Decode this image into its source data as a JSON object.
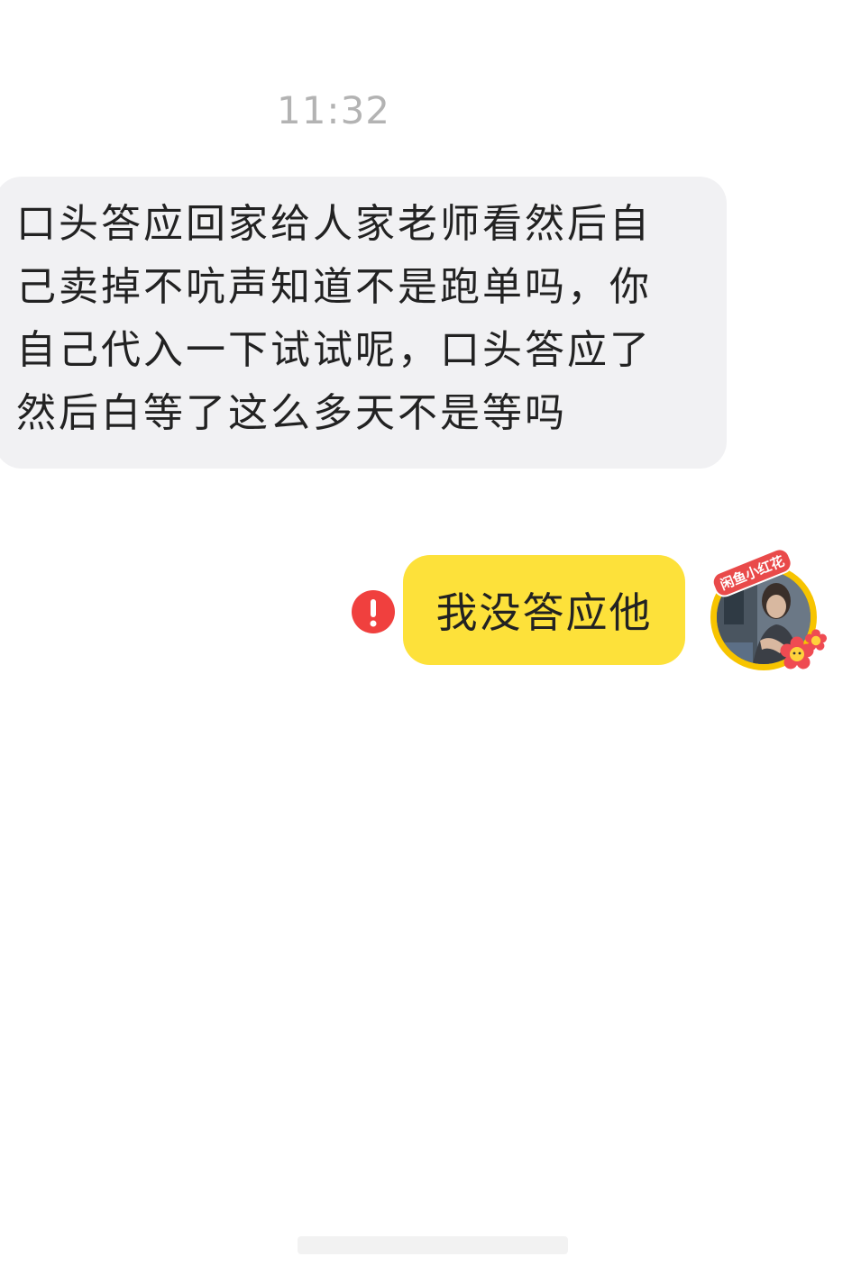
{
  "chat": {
    "timestamp": "11:32",
    "messages": [
      {
        "direction": "incoming",
        "text": "口头答应回家给人家老师看然后自己卖掉不吭声知道不是跑单吗，你自己代入一下试试呢，口头答应了然后白等了这么多天不是等吗"
      },
      {
        "direction": "outgoing",
        "text": "我没答应他",
        "status_icon": "error-icon"
      }
    ],
    "avatar": {
      "badge_text": "闲鱼小红花",
      "icon": "flower-icon"
    }
  },
  "colors": {
    "incoming_bubble": "#f1f1f3",
    "outgoing_bubble": "#fde13a",
    "error": "#f0403e",
    "timestamp": "#b3b3b3"
  }
}
